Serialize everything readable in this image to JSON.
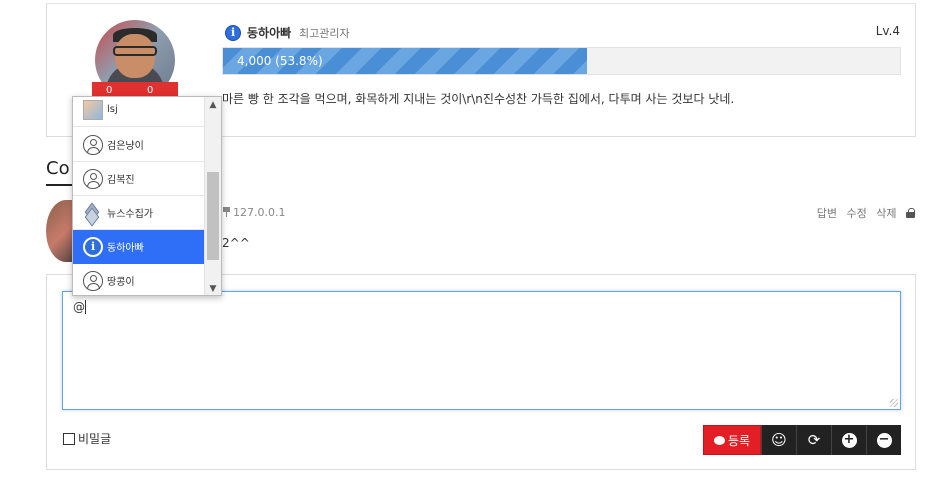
{
  "profile": {
    "nickname": "동하아빠",
    "role": "최고관리자",
    "level": "Lv.4",
    "exp_text": "4,000 (53.8%)",
    "exp_fraction": 0.538,
    "signature": "마른 빵 한 조각을 먹으며, 화목하게 지내는 것이\\r\\n진수성찬 가득한 집에서, 다투며 사는 것보다 낫네.",
    "vote_up": "0",
    "vote_down": "0"
  },
  "comments": {
    "title": "Co",
    "items": [
      {
        "ip": "127.0.0.1",
        "body": "2^^",
        "actions": [
          "답변",
          "수정",
          "삭제"
        ]
      }
    ]
  },
  "write": {
    "textarea_value": "@",
    "secret_label": "비밀글",
    "submit_label": "등록",
    "colors": {
      "submit": "#e31e24",
      "toolbar": "#222222",
      "focus": "#66a3e0"
    }
  },
  "mention_dropdown": {
    "items": [
      {
        "name": "lsj",
        "icon": "photo-icon",
        "active": false
      },
      {
        "name": "검은냥이",
        "icon": "person-icon",
        "active": false
      },
      {
        "name": "김복진",
        "icon": "person-icon",
        "active": false
      },
      {
        "name": "뉴스수집가",
        "icon": "layers-icon",
        "active": false
      },
      {
        "name": "동하아빠",
        "icon": "info-icon",
        "active": true
      },
      {
        "name": "땅콩이",
        "icon": "person-icon",
        "active": false
      }
    ],
    "active_color": "#2f6ef6"
  }
}
